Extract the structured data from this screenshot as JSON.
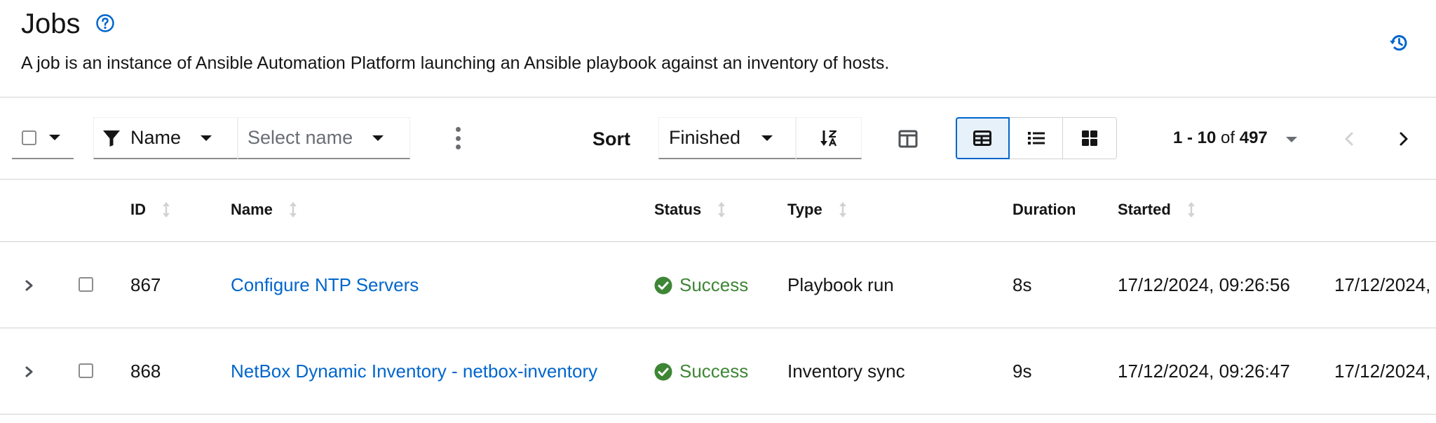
{
  "header": {
    "title": "Jobs",
    "description": "A job is an instance of Ansible Automation Platform launching an Ansible playbook against an inventory of hosts."
  },
  "toolbar": {
    "filter_attribute": "Name",
    "filter_placeholder": "Select name",
    "sort_label": "Sort",
    "sort_value": "Finished",
    "pagination": {
      "start_end": "1 - 10",
      "of": "of",
      "total": "497"
    }
  },
  "table": {
    "columns": {
      "id": "ID",
      "name": "Name",
      "status": "Status",
      "type": "Type",
      "duration": "Duration",
      "started": "Started"
    },
    "rows": [
      {
        "id": "867",
        "name": "Configure NTP Servers",
        "status": "Success",
        "type": "Playbook run",
        "duration": "8s",
        "started": "17/12/2024, 09:26:56",
        "finished": "17/12/2024,"
      },
      {
        "id": "868",
        "name": "NetBox Dynamic Inventory - netbox-inventory",
        "status": "Success",
        "type": "Inventory sync",
        "duration": "9s",
        "started": "17/12/2024, 09:26:47",
        "finished": "17/12/2024,"
      }
    ]
  },
  "colors": {
    "link": "#0066cc",
    "success": "#3e8635",
    "border": "#d2d2d2",
    "active_toggle_bg": "#e7f1fa"
  },
  "icons": {
    "help": "help-circle-icon",
    "history": "history-icon",
    "filter": "filter-icon",
    "kebab": "kebab-icon",
    "sort_direction": "sort-alpha-down-icon",
    "columns": "columns-icon",
    "view_table": "table-view-icon",
    "view_list": "list-view-icon",
    "view_cards": "card-view-icon",
    "success": "check-circle-icon",
    "expand": "chevron-right-icon"
  }
}
